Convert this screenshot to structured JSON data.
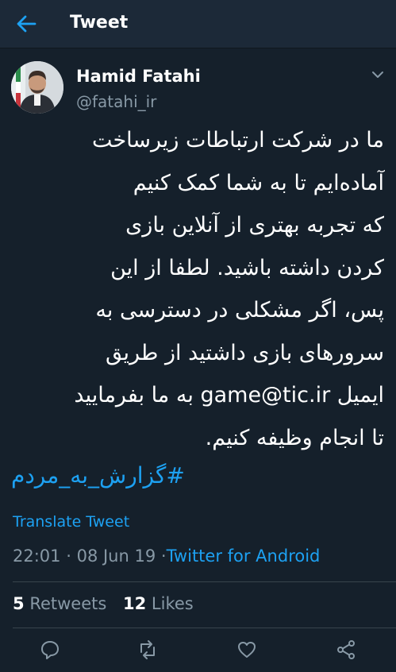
{
  "header": {
    "title": "Tweet",
    "back_icon": "arrow-left-icon"
  },
  "author": {
    "name": "Hamid Fatahi",
    "handle": "@fatahi_ir"
  },
  "tweet": {
    "lines": [
      "ما در شرکت ارتباطات زیرساخت",
      "آماده‌ایم تا به شما کمک کنیم",
      "که تجربه بهتری از آنلاین بازی",
      "کردن داشته باشید. لطفا از این",
      "پس، اگر مشکلی در دسترسی به",
      "سرورهای بازی داشتید از طریق",
      "ایمیل",
      "game@tic.ir",
      "به ما بفرمایید",
      "تا انجام وظیفه کنیم."
    ],
    "hashtag": "#گزارش_به_مردم",
    "translate_label": "Translate Tweet",
    "time": "22:01",
    "separator": "·",
    "date": "08 Jun 19",
    "source": "Twitter for Android"
  },
  "stats": {
    "retweets_count": "5",
    "retweets_label": "Retweets",
    "likes_count": "12",
    "likes_label": "Likes"
  },
  "actions": [
    "reply-icon",
    "retweet-icon",
    "like-icon",
    "share-icon"
  ],
  "colors": {
    "background": "#15202b",
    "accent": "#1da1f2",
    "muted": "#8899a6"
  }
}
